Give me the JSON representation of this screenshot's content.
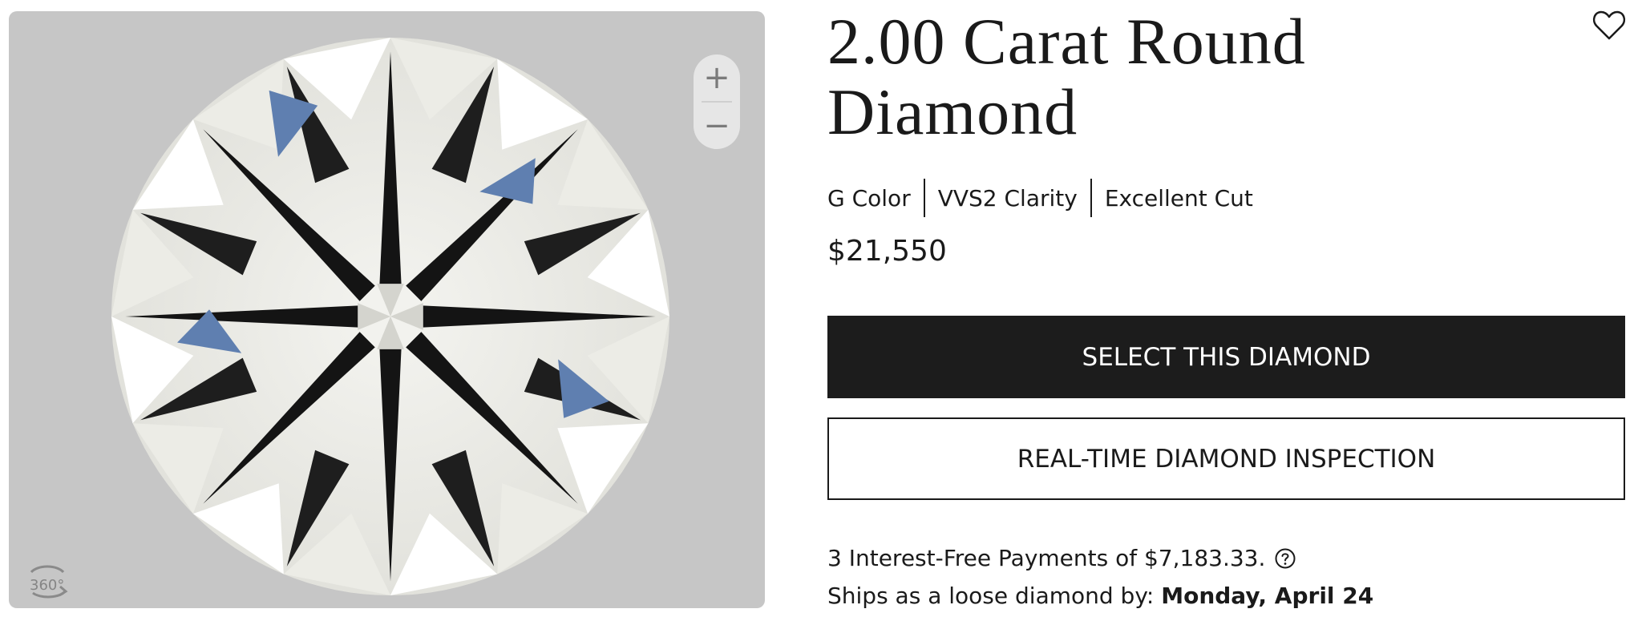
{
  "product": {
    "title": "2.00 Carat Round Diamond",
    "attributes": [
      "G Color",
      "VVS2 Clarity",
      "Excellent Cut"
    ],
    "price": "$21,550"
  },
  "viewer": {
    "zoom_in_label": "+",
    "zoom_out_label": "−",
    "rotate_label": "360°"
  },
  "actions": {
    "select_label": "SELECT THIS DIAMOND",
    "inspection_label": "REAL-TIME DIAMOND INSPECTION"
  },
  "financing": {
    "payments_text": "3 Interest-Free Payments of $7,183.33.",
    "help_icon": "question-circle-icon"
  },
  "shipping": {
    "label": "Ships as a loose diamond by:",
    "date": "Monday, April 24"
  },
  "icons": {
    "favorite": "heart-outline-icon"
  },
  "colors": {
    "primary_button": "#1c1c1c",
    "viewer_background": "#c6c6c6",
    "text": "#1a1a1a"
  }
}
